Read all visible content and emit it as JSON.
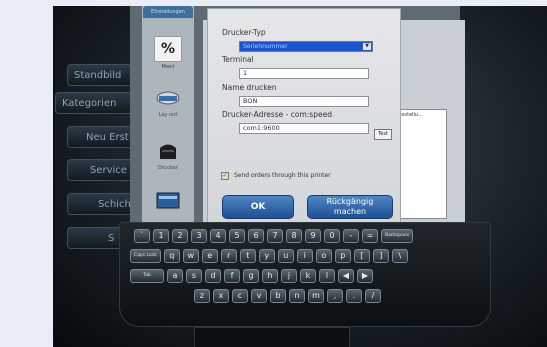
{
  "background_app": {
    "tab_label": "Einstellungen",
    "side_buttons": [
      "Standbild",
      "Kategorien",
      "Neu Erst",
      "Service",
      "Schich",
      "S"
    ],
    "tools": [
      {
        "label": "Mwst",
        "icon": "percent-icon"
      },
      {
        "label": "Lay out",
        "icon": "printer-drive-icon"
      },
      {
        "label": "Drucker",
        "icon": "printer-icon"
      },
      {
        "label": "",
        "icon": "card-reader-icon"
      }
    ],
    "right_list_header": "Bestellu..."
  },
  "dialog": {
    "printer_type_label": "Drucker-Typ",
    "printer_type_value": "Seriennummer",
    "terminal_label": "Terminal",
    "terminal_value": "1",
    "print_name_label": "Name drucken",
    "print_name_value": "BON",
    "printer_address_label": "Drucker-Adresse  - com:speed",
    "printer_address_value": "com1:9600",
    "test_button": "Test",
    "send_orders_label": "Send orders through this printer",
    "send_orders_checked": true,
    "ok_button": "OK",
    "undo_button_line1": "Rückgängig",
    "undo_button_line2": "machen"
  },
  "keyboard": {
    "row1": [
      "`",
      "1",
      "2",
      "3",
      "4",
      "5",
      "6",
      "7",
      "8",
      "9",
      "0",
      "-",
      "=",
      "Backspace"
    ],
    "row2": [
      "Caps Lock",
      "q",
      "w",
      "e",
      "r",
      "t",
      "y",
      "u",
      "i",
      "o",
      "p",
      "[",
      "]",
      "\\"
    ],
    "row3": [
      "Tab",
      "a",
      "s",
      "d",
      "f",
      "g",
      "h",
      "j",
      "k",
      "l",
      "◀",
      "▶"
    ],
    "row4": [
      "z",
      "x",
      "c",
      "v",
      "b",
      "n",
      "m",
      ",",
      ".",
      "/"
    ]
  }
}
